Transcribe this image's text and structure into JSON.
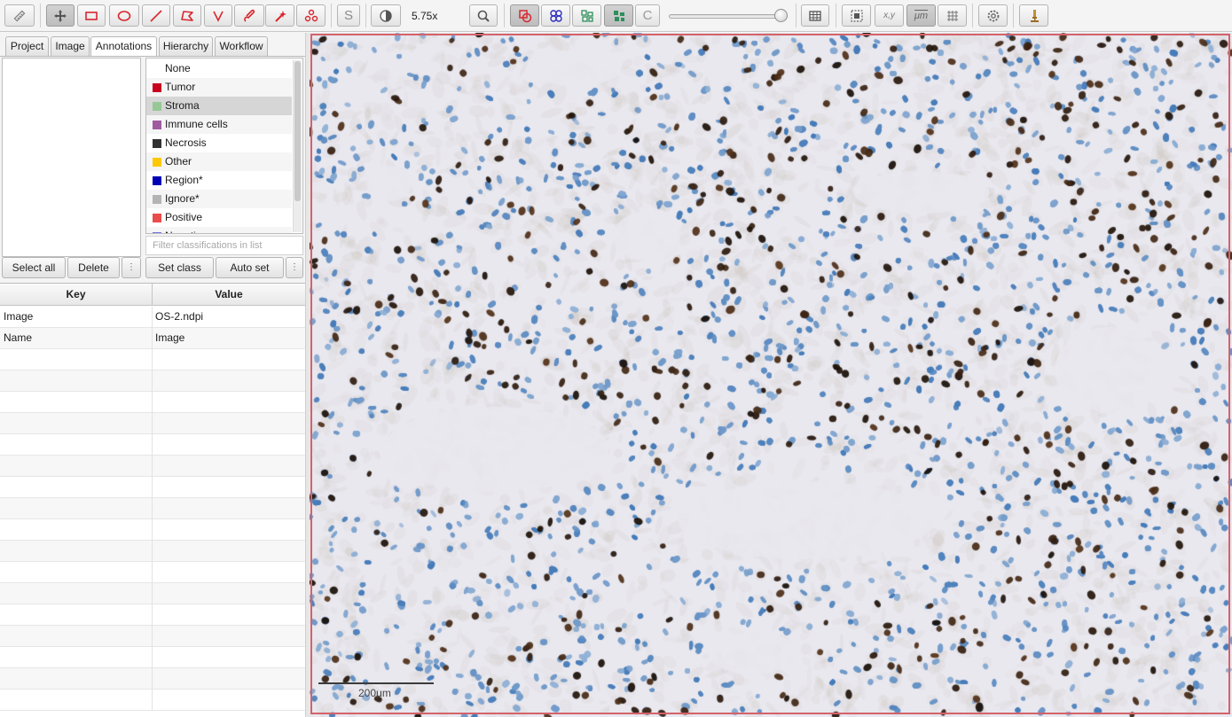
{
  "toolbar": {
    "zoom_text": "5.75x",
    "slider_value": 0.98,
    "tools": [
      {
        "name": "measure-icon",
        "active": false
      },
      {
        "name": "move-icon",
        "active": true
      },
      {
        "name": "rectangle-icon",
        "active": false
      },
      {
        "name": "ellipse-icon",
        "active": false
      },
      {
        "name": "line-icon",
        "active": false
      },
      {
        "name": "polygon-icon",
        "active": false
      },
      {
        "name": "polyline-icon",
        "active": false
      },
      {
        "name": "brush-icon",
        "active": false
      },
      {
        "name": "wand-icon",
        "active": false
      },
      {
        "name": "points-icon",
        "active": false
      },
      {
        "name": "selection-mode-icon",
        "active": false
      },
      {
        "name": "contrast-icon",
        "active": false
      },
      {
        "name": "zoom-to-fit-icon",
        "active": false
      },
      {
        "name": "show-annotations-icon",
        "active": true
      },
      {
        "name": "show-tma-grid-icon",
        "active": false
      },
      {
        "name": "show-detections-icon",
        "active": false
      },
      {
        "name": "fill-detections-icon",
        "active": true
      },
      {
        "name": "connections-icon",
        "active": false
      },
      {
        "name": "table-icon",
        "active": false
      },
      {
        "name": "overview-icon",
        "active": false
      },
      {
        "name": "cursor-location-icon",
        "active": false
      },
      {
        "name": "scalebar-toggle-icon",
        "active": false
      },
      {
        "name": "grid-icon",
        "active": false
      },
      {
        "name": "preferences-icon",
        "active": false
      },
      {
        "name": "microscope-icon",
        "active": false
      }
    ],
    "labels": {
      "selection_mode": "S",
      "connections": "C",
      "cursor_location": "x,y",
      "scalebar_toggle": "μm"
    }
  },
  "tabs": [
    "Project",
    "Image",
    "Annotations",
    "Hierarchy",
    "Workflow"
  ],
  "active_tab": "Annotations",
  "classes": [
    {
      "label": "None",
      "color": ""
    },
    {
      "label": "Tumor",
      "color": "#c8001e"
    },
    {
      "label": "Stroma",
      "color": "#96c896"
    },
    {
      "label": "Immune cells",
      "color": "#a05aa0"
    },
    {
      "label": "Necrosis",
      "color": "#323232"
    },
    {
      "label": "Other",
      "color": "#ffc800"
    },
    {
      "label": "Region*",
      "color": "#0000b4"
    },
    {
      "label": "Ignore*",
      "color": "#b4b4b4"
    },
    {
      "label": "Positive",
      "color": "#ea4b4b"
    },
    {
      "label": "Negative",
      "color": "#7070e0"
    }
  ],
  "selected_class": "Stroma",
  "filter": {
    "placeholder": "Filter classifications in list",
    "value": ""
  },
  "buttons": {
    "select_all": "Select all",
    "delete": "Delete",
    "more": "⋮",
    "set_class": "Set class",
    "auto_set": "Auto set"
  },
  "kv_table": {
    "key_header": "Key",
    "value_header": "Value",
    "rows": [
      {
        "key": "Image",
        "value": "OS-2.ndpi"
      },
      {
        "key": "Name",
        "value": "Image"
      }
    ],
    "empty_rows": 17
  },
  "viewer": {
    "scalebar_label": "200μm",
    "colors": {
      "background": "#e9e8ef",
      "border": "#d4626a",
      "hematoxylin": "#5d8dc6",
      "dab": "#3a2414"
    }
  }
}
